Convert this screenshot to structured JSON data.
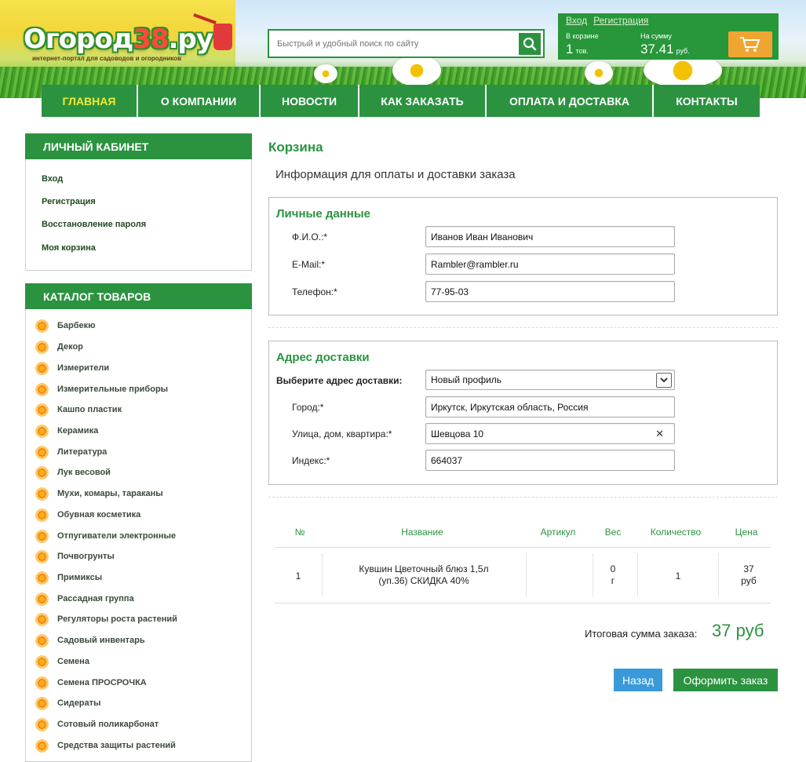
{
  "header": {
    "logo_main": "Огород",
    "logo_num": "38",
    "logo_tld": ".ру",
    "tagline": "интернет-портал для садоводов и огородников",
    "search_placeholder": "Быстрый и удобный поиск по сайту",
    "auth": {
      "login": "Вход",
      "register": "Регистрация"
    },
    "cart": {
      "count_label": "В корзине",
      "count_value": "1",
      "count_unit": "тов.",
      "sum_label": "На сумму",
      "sum_value": "37.41",
      "sum_unit": "руб."
    }
  },
  "nav": {
    "items": [
      {
        "label": "ГЛАВНАЯ",
        "active": true
      },
      {
        "label": "О КОМПАНИИ"
      },
      {
        "label": "НОВОСТИ"
      },
      {
        "label": "КАК ЗАКАЗАТЬ"
      },
      {
        "label": "ОПЛАТА И ДОСТАВКА"
      },
      {
        "label": "КОНТАКТЫ"
      }
    ]
  },
  "account": {
    "title": "ЛИЧНЫЙ КАБИНЕТ",
    "links": [
      "Вход",
      "Регистрация",
      "Восстановление пароля",
      "Моя корзина"
    ]
  },
  "catalog": {
    "title": "КАТАЛОГ ТОВАРОВ",
    "items": [
      "Барбекю",
      "Декор",
      "Измерители",
      "Измерительные приборы",
      "Кашпо пластик",
      "Керамика",
      "Литература",
      "Лук весовой",
      "Мухи, комары, тараканы",
      "Обувная косметика",
      "Отпугиватели электронные",
      "Почвогрунты",
      "Примиксы",
      "Рассадная группа",
      "Регуляторы роста растений",
      "Садовый инвентарь",
      "Семена",
      "Семена ПРОСРОЧКА",
      "Сидераты",
      "Сотовый поликарбонат",
      "Средства защиты растений"
    ]
  },
  "main": {
    "title": "Корзина",
    "subtitle": "Информация для оплаты и доставки заказа",
    "personal": {
      "title": "Личные данные",
      "fio_label": "Ф.И.О.:*",
      "fio_value": "Иванов Иван Иванович",
      "email_label": "E-Mail:*",
      "email_value": "Rambler@rambler.ru",
      "phone_label": "Телефон:*",
      "phone_value": "77-95-03"
    },
    "delivery": {
      "title": "Адрес доставки",
      "select_label": "Выберите адрес доставки:",
      "select_value": "Новый профиль",
      "city_label": "Город:*",
      "city_value": "Иркутск, Иркутская область, Россия",
      "street_label": "Улица, дом, квартира:*",
      "street_value": "Шевцова 10",
      "zip_label": "Индекс:*",
      "zip_value": "664037"
    },
    "table": {
      "headers": [
        "№",
        "Название",
        "Артикул",
        "Вес",
        "Количество",
        "Цена"
      ],
      "rows": [
        {
          "num": "1",
          "name1": "Кувшин Цветочный блюз 1,5л",
          "name2": "(уп.36) СКИДКА 40%",
          "article": "",
          "weight1": "0",
          "weight2": "г",
          "qty": "1",
          "price1": "37",
          "price2": "руб"
        }
      ]
    },
    "total_label": "Итоговая сумма заказа:",
    "total_value": "37 руб",
    "back_button": "Назад",
    "order_button": "Оформить заказ"
  },
  "colors": {
    "brand_green": "#2b9340",
    "nav_active": "#f6e730",
    "back_button": "#3a9ad9",
    "cart_button": "#f0a533"
  }
}
